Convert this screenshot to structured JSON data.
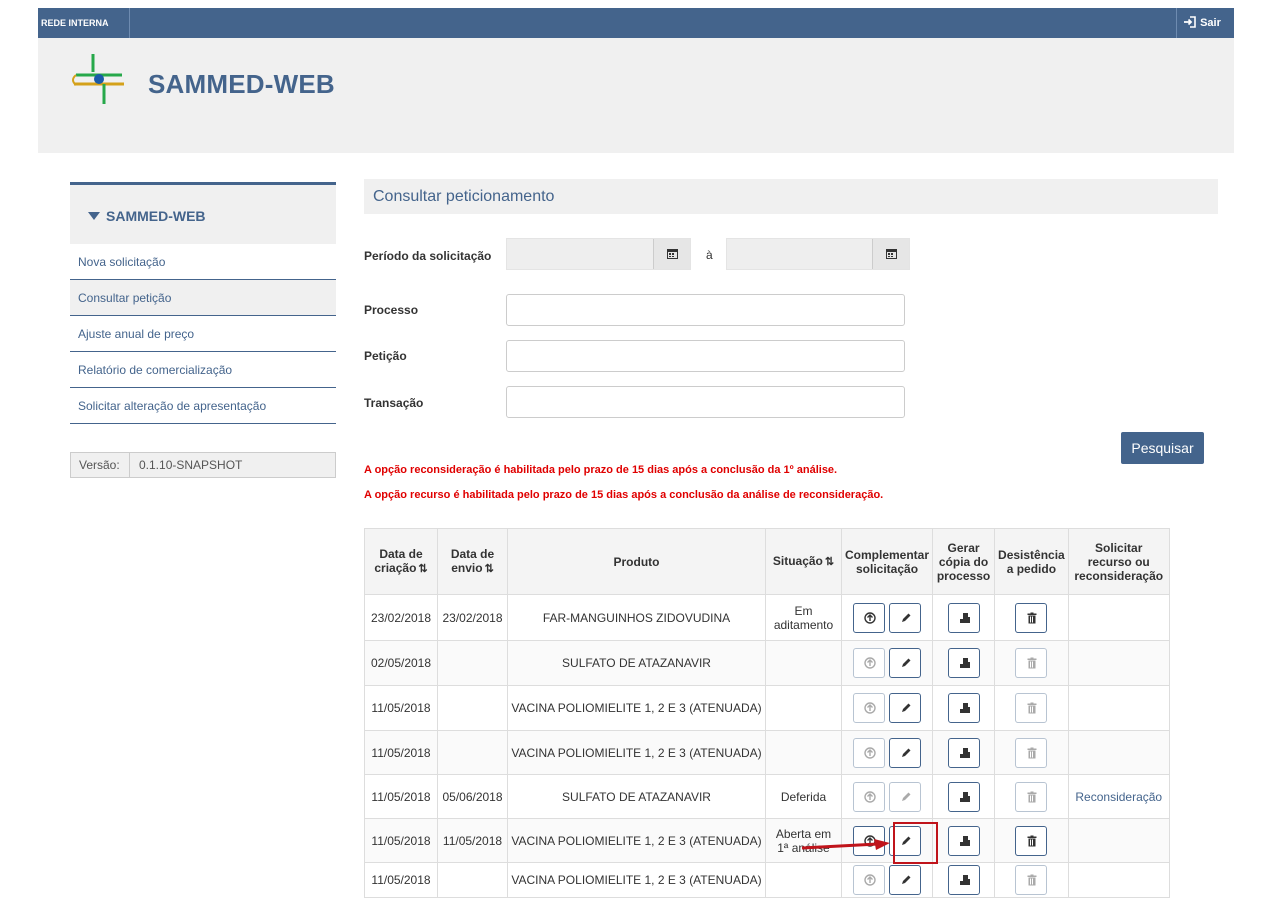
{
  "topbar": {
    "network_label": "REDE INTERNA",
    "exit_label": "Sair"
  },
  "header": {
    "brand": "SAMMED-WEB"
  },
  "sidebar": {
    "title": "SAMMED-WEB",
    "items": [
      {
        "label": "Nova solicitação"
      },
      {
        "label": "Consultar petição"
      },
      {
        "label": "Ajuste anual de preço"
      },
      {
        "label": "Relatório de comercialização"
      },
      {
        "label": "Solicitar alteração de apresentação"
      }
    ],
    "version_label": "Versão:",
    "version_value": "0.1.10-SNAPSHOT"
  },
  "main": {
    "title": "Consultar peticionamento",
    "period_label": "Período da solicitação",
    "period_sep": "à",
    "process_label": "Processo",
    "petition_label": "Petição",
    "transaction_label": "Transação",
    "search_button": "Pesquisar",
    "note1": "A opção reconsideração é habilitada pelo prazo de 15 dias após a conclusão da 1º análise.",
    "note2": "A opção recurso é habilitada pelo prazo de 15 dias após a conclusão da análise de reconsideração."
  },
  "table": {
    "headers": {
      "created_1": "Data de",
      "created_2": "criação",
      "sent_1": "Data de",
      "sent_2": "envio",
      "product": "Produto",
      "status": "Situação",
      "complement_1": "Complementar",
      "complement_2": "solicitação",
      "copy_1": "Gerar",
      "copy_2": "cópia do",
      "copy_3": "processo",
      "withdraw_1": "Desistência",
      "withdraw_2": "a pedido",
      "appeal_1": "Solicitar",
      "appeal_2": "recurso ou",
      "appeal_3": "reconsideração",
      "sort_icon": "sort-icon"
    },
    "rows": [
      {
        "created": "23/02/2018",
        "sent": "23/02/2018",
        "product": "FAR-MANGUINHOS ZIDOVUDINA",
        "status_1": "Em",
        "status_2": "aditamento",
        "action": ""
      },
      {
        "created": "02/05/2018",
        "sent": "",
        "product": "SULFATO DE ATAZANAVIR",
        "status_1": "",
        "status_2": "",
        "action": ""
      },
      {
        "created": "11/05/2018",
        "sent": "",
        "product": "VACINA POLIOMIELITE 1, 2 E 3 (ATENUADA)",
        "status_1": "",
        "status_2": "",
        "action": ""
      },
      {
        "created": "11/05/2018",
        "sent": "",
        "product": "VACINA POLIOMIELITE 1, 2 E 3 (ATENUADA)",
        "status_1": "",
        "status_2": "",
        "action": ""
      },
      {
        "created": "11/05/2018",
        "sent": "05/06/2018",
        "product": "SULFATO DE ATAZANAVIR",
        "status_1": "Deferida",
        "status_2": "",
        "action": "Reconsideração"
      },
      {
        "created": "11/05/2018",
        "sent": "11/05/2018",
        "product": "VACINA POLIOMIELITE 1, 2 E 3 (ATENUADA)",
        "status_1": "Aberta em",
        "status_2": "1ª análise",
        "action": ""
      },
      {
        "created": "11/05/2018",
        "sent": "",
        "product": "VACINA POLIOMIELITE 1, 2 E 3 (ATENUADA)",
        "status_1": "",
        "status_2": "",
        "action": ""
      }
    ]
  },
  "colors": {
    "primary": "#44648c",
    "warning": "#e00000",
    "highlight": "#c0141b",
    "header_bg": "#f0f0f0"
  }
}
